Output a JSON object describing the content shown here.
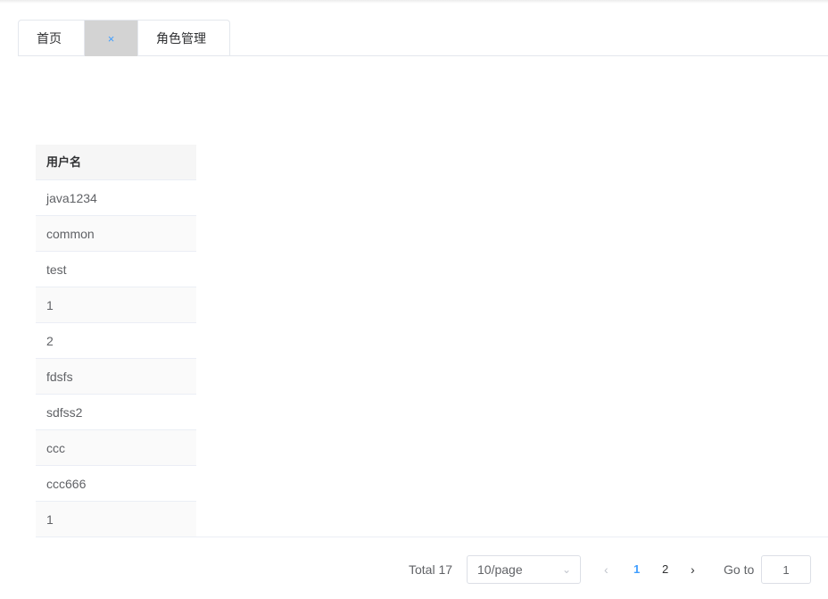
{
  "tabs": {
    "home_label": "首页",
    "close_glyph": "×",
    "role_label": "角色管理"
  },
  "table": {
    "header": "用户名",
    "rows": [
      "java1234",
      "common",
      "test",
      "1",
      "2",
      "fdsfs",
      "sdfss2",
      "ccc",
      "ccc666",
      "1"
    ]
  },
  "pagination": {
    "total": "Total 17",
    "page_size": "10/page",
    "prev_glyph": "‹",
    "next_glyph": "›",
    "pages": [
      "1",
      "2"
    ],
    "current_page": "1",
    "goto_label": "Go to",
    "goto_value": "1",
    "active_color": "#409eff"
  }
}
